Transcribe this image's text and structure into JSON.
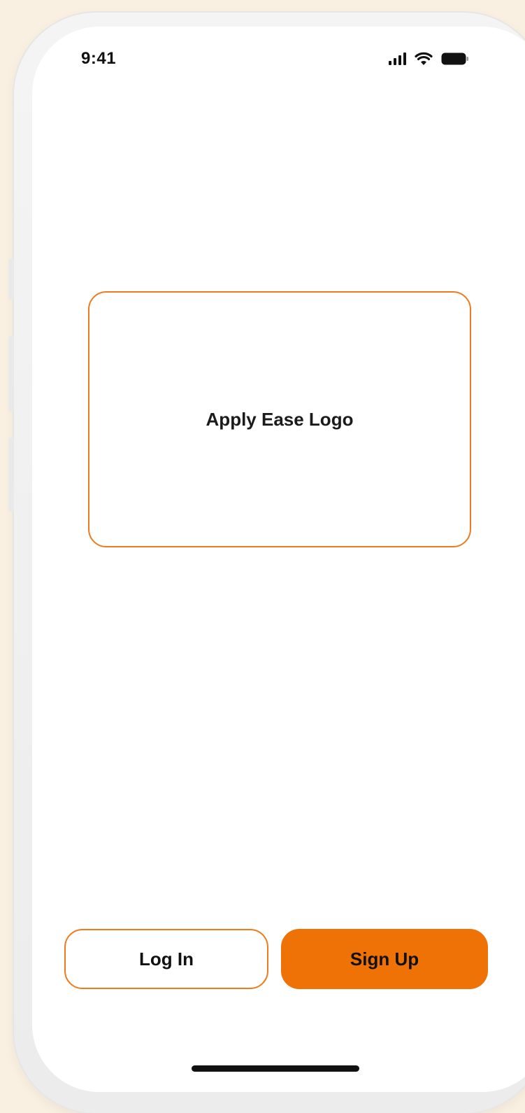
{
  "status_bar": {
    "time": "9:41",
    "icons": [
      "signal-icon",
      "wifi-icon",
      "battery-icon"
    ]
  },
  "logo": {
    "text": "Apply Ease Logo"
  },
  "buttons": {
    "login_label": "Log In",
    "signup_label": "Sign Up"
  },
  "colors": {
    "accent": "#EE7B1E",
    "primary_button": "#EE7205",
    "background": "#FAF0E2",
    "screen": "#FFFFFF",
    "text": "#111111"
  }
}
